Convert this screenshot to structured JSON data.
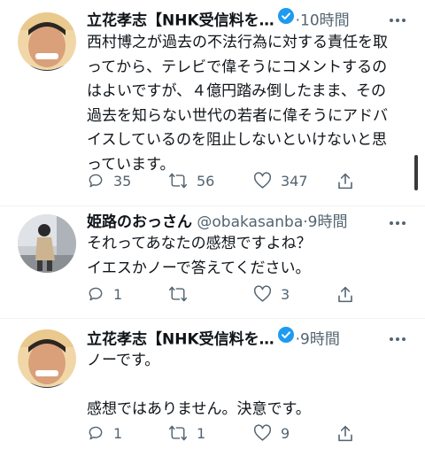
{
  "tweets": [
    {
      "name": "立花孝志【NHK受信料を…",
      "handle": "",
      "time": "·10時間",
      "text": "西村博之が過去の不法行為に対する責任を取\nってから、テレビで偉そうにコメントするの\nはよいですが、４億円踏み倒したまま、その\n過去を知らない世代の若者に偉そうにアドバ\nイスしているのを阻止しないといけないと思\nっています。",
      "replies": "35",
      "retweets": "56",
      "likes": "347"
    },
    {
      "name": "姫路のおっさん",
      "handle": "@obakasanba",
      "time": "·9時間",
      "text": "それってあなたの感想ですよね？\nイエスかノーで答えてください。",
      "replies": "1",
      "retweets": "",
      "likes": "3"
    },
    {
      "name": "立花孝志【NHK受信料を…",
      "handle": "",
      "time": "·9時間",
      "text": "ノーです。\n\n感想ではありません。決意です。",
      "replies": "1",
      "retweets": "1",
      "likes": "9"
    }
  ],
  "icons": [
    "reply-icon",
    "retweet-icon",
    "like-icon",
    "share-icon",
    "verified-badge-icon",
    "more-icon"
  ],
  "colors": {
    "text": "#0f1419",
    "muted": "#536471",
    "verified": "#1d9bf0"
  }
}
